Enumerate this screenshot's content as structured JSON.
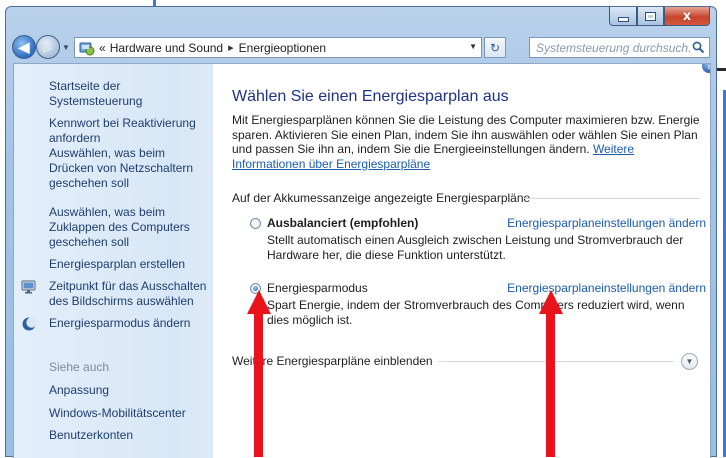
{
  "window": {
    "caption_buttons": {
      "minimize": "minimize",
      "maximize": "maximize",
      "close": "x"
    }
  },
  "navbar": {
    "breadcrumb_prefix": "«",
    "breadcrumb": [
      "Hardware und Sound",
      "Energieoptionen"
    ],
    "breadcrumb_separator": "▸",
    "search_placeholder": "Systemsteuerung durchsuch..."
  },
  "sidebar": {
    "home": "Startseite der Systemsteuerung",
    "items": [
      {
        "label": "Kennwort bei Reaktivierung anfordern",
        "icon": ""
      },
      {
        "label": "Auswählen, was beim Drücken von Netzschaltern geschehen soll",
        "icon": ""
      },
      {
        "label": "Auswählen, was beim Zuklappen des Computers geschehen soll",
        "icon": ""
      },
      {
        "label": "Energiesparplan erstellen",
        "icon": ""
      },
      {
        "label": "Zeitpunkt für das Ausschalten des Bildschirms auswählen",
        "icon": "monitor-icon"
      },
      {
        "label": "Energiesparmodus ändern",
        "icon": "moon-icon"
      }
    ],
    "see_also_title": "Siehe auch",
    "see_also": [
      "Anpassung",
      "Windows-Mobilitätscenter",
      "Benutzerkonten"
    ]
  },
  "main": {
    "heading": "Wählen Sie einen Energiesparplan aus",
    "intro": "Mit Energiesparplänen können Sie die Leistung des Computer maximieren bzw. Energie sparen. Aktivieren Sie einen Plan, indem Sie ihn auswählen oder wählen Sie einen Plan und passen Sie ihn an, indem Sie die Energieeinstellungen ändern.",
    "intro_link": "Weitere Informationen über Energiesparpläne",
    "group_title": "Auf der Akkumessanzeige angezeigte Energiesparpläne",
    "plans": [
      {
        "name": "Ausbalanciert (empfohlen)",
        "selected": false,
        "link": "Energiesparplaneinstellungen ändern",
        "description": "Stellt automatisch einen Ausgleich zwischen Leistung und Stromverbrauch der Hardware her, die diese Funktion unterstützt."
      },
      {
        "name": "Energiesparmodus",
        "selected": true,
        "link": "Energiesparplaneinstellungen ändern",
        "description": "Spart Energie, indem der Stromverbrauch des Computers reduziert wird, wenn dies möglich ist."
      }
    ],
    "more_plans": "Weitere Energiesparpläne einblenden"
  },
  "colors": {
    "link": "#1a5bb0",
    "heading": "#1e3287",
    "annotation_arrow": "#e8131b"
  }
}
